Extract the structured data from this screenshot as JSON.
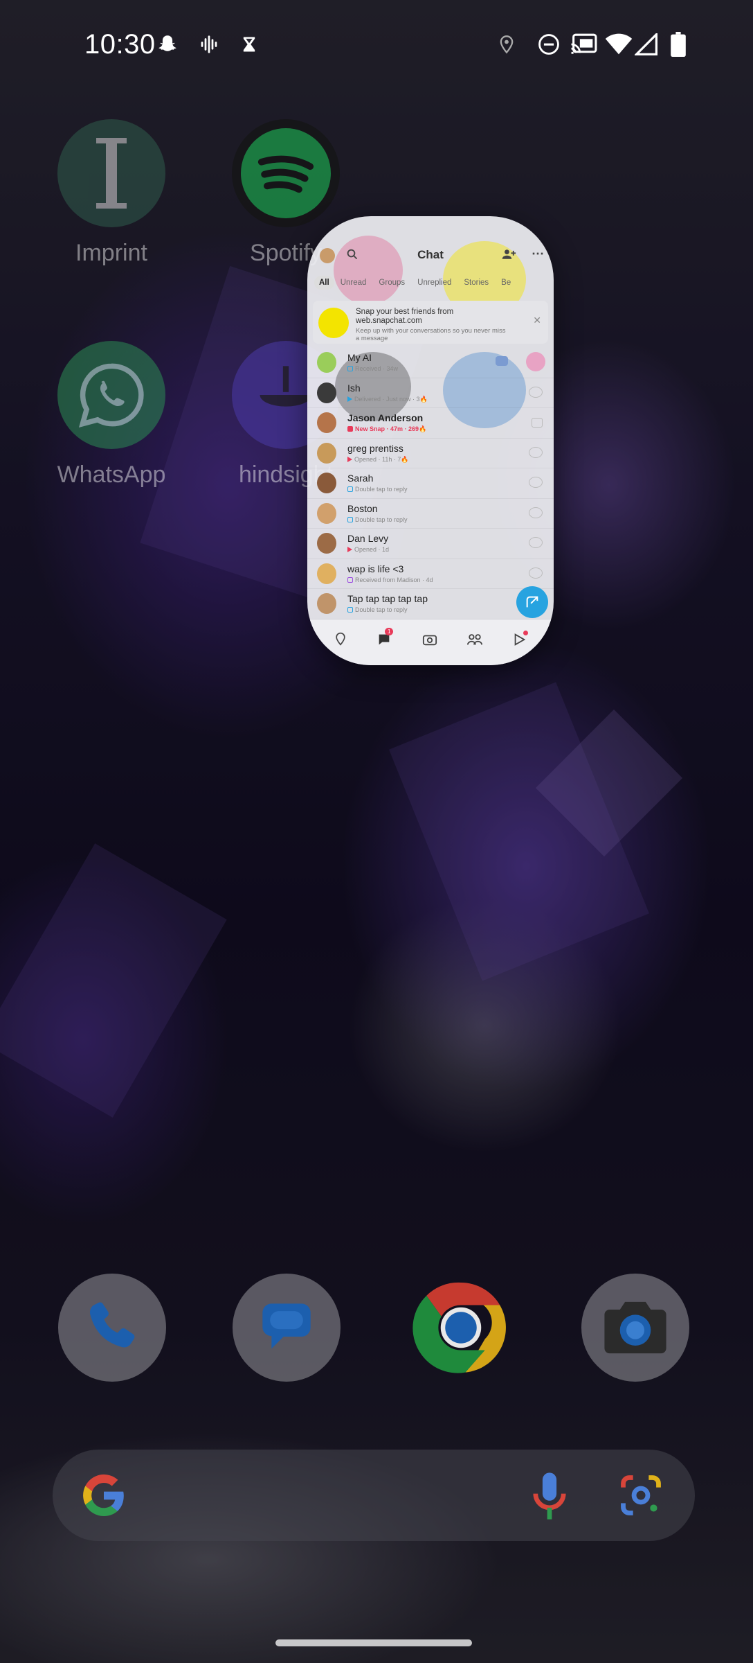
{
  "status_bar": {
    "time": "10:30",
    "icons": [
      "snapchat-icon",
      "voice-recorder-icon",
      "hourglass-icon",
      "location-icon",
      "do-not-disturb-icon",
      "cast-icon",
      "wifi-icon",
      "signal-icon",
      "battery-icon"
    ]
  },
  "home_apps": [
    {
      "label": "Imprint",
      "icon": "imprint-icon"
    },
    {
      "label": "Spotify",
      "icon": "spotify-icon"
    },
    {
      "label": "WhatsApp",
      "icon": "whatsapp-icon"
    },
    {
      "label": "hindsight",
      "icon": "hindsight-icon"
    }
  ],
  "floating_window": {
    "app": "Snapchat",
    "title": "Chat",
    "tabs": [
      "All",
      "Unread",
      "Groups",
      "Unreplied",
      "Stories",
      "Be"
    ],
    "banner": {
      "title": "Snap your best friends from web.snapchat.com",
      "subtitle": "Keep up with your conversations so you never miss a message"
    },
    "chats": [
      {
        "name": "My AI",
        "status": "Received · 34w",
        "marker": "chat",
        "right": "snap-avatar-badge"
      },
      {
        "name": "Ish",
        "status": "Delivered · Just now · 3🔥",
        "marker": "sent",
        "right": "eye"
      },
      {
        "name": "Jason Anderson",
        "status": "New Snap · 47m · 269🔥",
        "marker": "new-snap",
        "right": "chat"
      },
      {
        "name": "greg prentiss",
        "status": "Opened · 11h · 7🔥",
        "marker": "opened",
        "right": "eye"
      },
      {
        "name": "Sarah",
        "status": "Double tap to reply",
        "marker": "chat",
        "right": "eye"
      },
      {
        "name": "Boston",
        "status": "Double tap to reply",
        "marker": "chat",
        "right": "eye"
      },
      {
        "name": "Dan Levy",
        "status": "Opened · 1d",
        "marker": "opened",
        "right": "eye"
      },
      {
        "name": "wap is life <3",
        "status": "Received from Madison · 4d",
        "marker": "chat",
        "right": "eye"
      },
      {
        "name": "Tap tap tap tap tap",
        "status": "Double tap to reply",
        "marker": "chat",
        "right": "none"
      }
    ],
    "nav": [
      "map-icon",
      "chat-icon",
      "camera-icon",
      "friends-icon",
      "stories-icon"
    ],
    "nav_badge": "1"
  },
  "dock": [
    "phone-icon",
    "messages-icon",
    "chrome-icon",
    "camera-icon"
  ],
  "colors": {
    "snap_blue": "#27a3e0",
    "snap_yellow": "#f3e400",
    "spotify_green": "#1db954",
    "whatsapp_green": "#25d366"
  }
}
